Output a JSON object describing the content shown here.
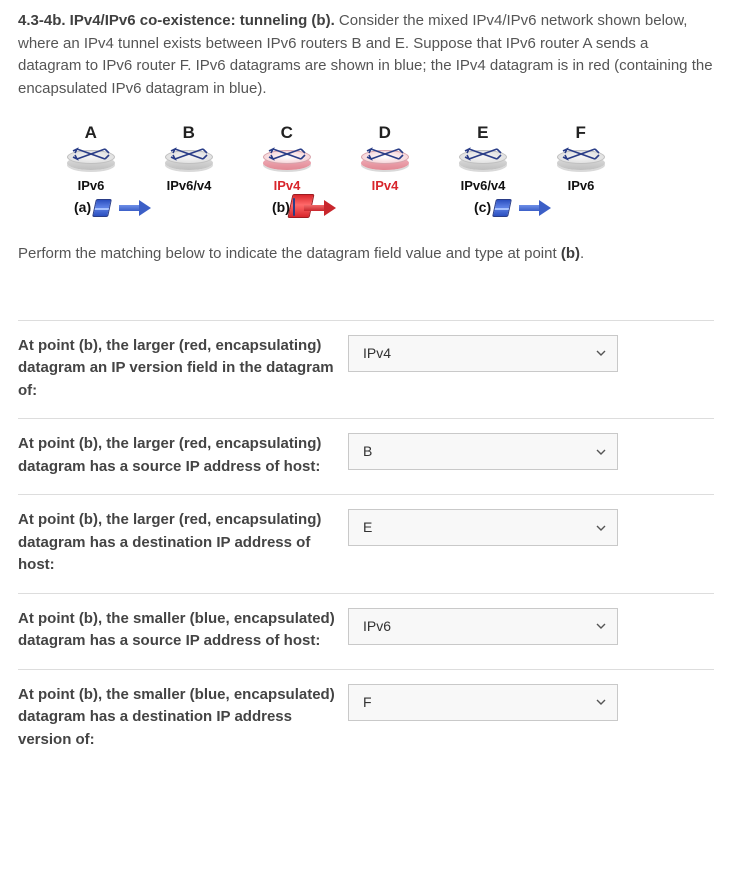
{
  "intro": {
    "lead": "4.3-4b. IPv4/IPv6 co-existence: tunneling (b).",
    "rest": "  Consider the mixed IPv4/IPv6 network shown below, where an IPv4 tunnel exists between IPv6 routers B and E. Suppose that IPv6 router A sends a datagram to IPv6 router F.  IPv6 datagrams are shown in blue; the IPv4 datagram is in red (containing the encapsulated IPv6 datagram in blue)."
  },
  "diagram": {
    "routers": [
      {
        "label": "A",
        "type": "IPv6",
        "type_color": "black",
        "skin": "grey"
      },
      {
        "label": "B",
        "type": "IPv6/v4",
        "type_color": "black",
        "skin": "grey"
      },
      {
        "label": "C",
        "type": "IPv4",
        "type_color": "red",
        "skin": "pink"
      },
      {
        "label": "D",
        "type": "IPv4",
        "type_color": "red",
        "skin": "pink"
      },
      {
        "label": "E",
        "type": "IPv6/v4",
        "type_color": "black",
        "skin": "grey"
      },
      {
        "label": "F",
        "type": "IPv6",
        "type_color": "black",
        "skin": "grey"
      }
    ],
    "annotations": {
      "a": "(a)",
      "b": "(b)",
      "c": "(c)"
    }
  },
  "instruction_prefix": "Perform the matching below to indicate the datagram field value and type at point ",
  "instruction_bold": "(b)",
  "instruction_suffix": ".",
  "questions": [
    {
      "text": "At point (b), the larger (red, encapsulating) datagram an IP version field in the datagram of:",
      "value": "IPv4"
    },
    {
      "text": "At point (b), the larger (red, encapsulating) datagram has a source IP address of host:&nbsp;",
      "value": "B"
    },
    {
      "text": "At point (b), the larger (red, encapsulating) datagram has a destination IP address of host:&nbsp;",
      "value": "E"
    },
    {
      "text": "At point (b), the smaller (blue, encapsulated) datagram has a source IP address of host:&nbsp;",
      "value": "IPv6"
    },
    {
      "text": "At point (b), the smaller (blue, encapsulated) datagram has a destination IP address version of:&nbsp;",
      "value": "F"
    }
  ]
}
